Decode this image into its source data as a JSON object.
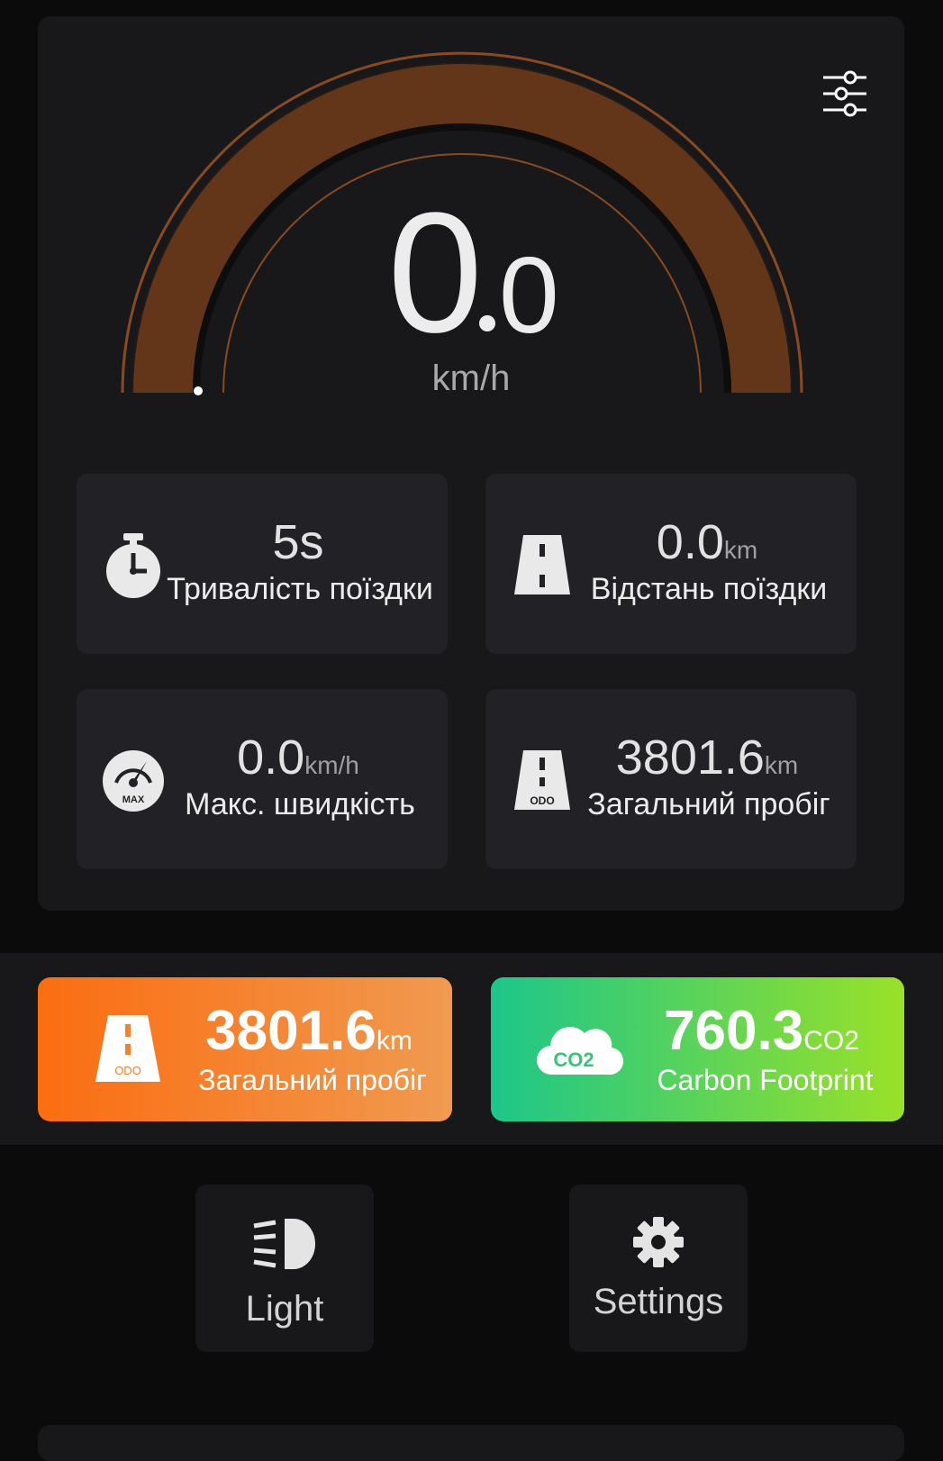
{
  "speedometer": {
    "speed_integer": "0",
    "speed_decimal": "0",
    "unit": "km/h",
    "gauge_fill_fraction": 0
  },
  "stats": [
    {
      "id": "trip-duration",
      "value": "5s",
      "unit": "",
      "label": "Тривалість поїздки",
      "icon": "stopwatch-icon"
    },
    {
      "id": "trip-distance",
      "value": "0.0",
      "unit": "km",
      "label": "Відстань поїздки",
      "icon": "road-icon"
    },
    {
      "id": "max-speed",
      "value": "0.0",
      "unit": "km/h",
      "label": "Макс. швидкість",
      "icon": "max-gauge-icon"
    },
    {
      "id": "total-mileage",
      "value": "3801.6",
      "unit": "km",
      "label": "Загальний пробіг",
      "icon": "odo-road-icon"
    }
  ],
  "highlights": {
    "odometer": {
      "value": "3801.6",
      "unit": "km",
      "label": "Загальний пробіг",
      "icon_text": "ODO",
      "color_start": "#fb6d10",
      "color_end": "#f09a50"
    },
    "carbon": {
      "value": "760.3",
      "unit": "CO2",
      "label": "Carbon Footprint",
      "icon_text": "CO2",
      "color_start": "#1cc68a",
      "color_end": "#9ae128"
    }
  },
  "controls": {
    "light_label": "Light",
    "settings_label": "Settings"
  },
  "icon_labels": {
    "max": "MAX",
    "odo": "ODO"
  },
  "colors": {
    "gauge": "#63361a",
    "gauge_ring": "#8a4a1f",
    "panel": "#18181a",
    "card": "#222226"
  }
}
